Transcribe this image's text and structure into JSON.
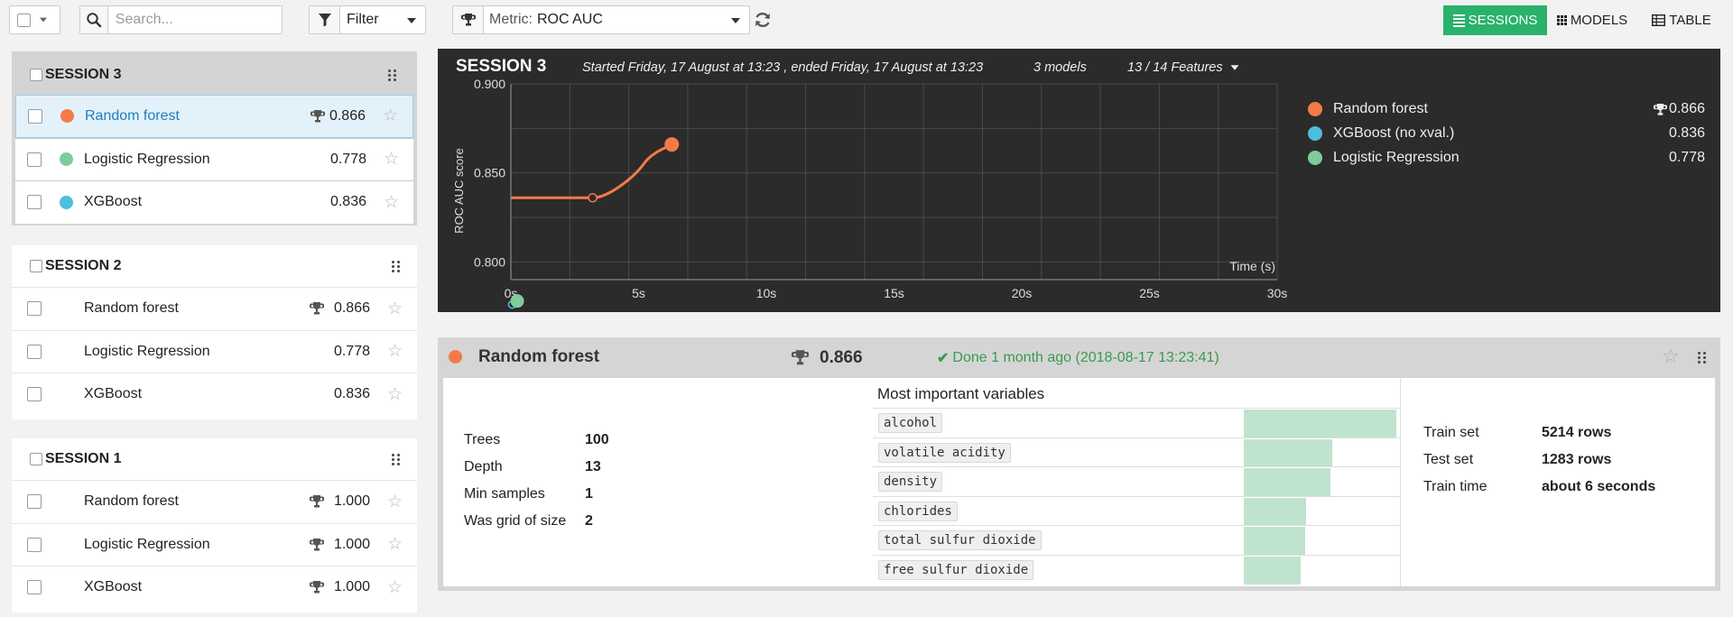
{
  "toolbar": {
    "search_placeholder": "Search...",
    "filter_label": "Filter",
    "metric_prefix": "Metric:",
    "metric_value": "ROC AUC",
    "views": [
      {
        "label": "SESSIONS",
        "active": true
      },
      {
        "label": "MODELS",
        "active": false
      },
      {
        "label": "TABLE",
        "active": false
      }
    ]
  },
  "sessions": [
    {
      "title": "SESSION 3",
      "models": [
        {
          "name": "Random forest",
          "color": "#f47b47",
          "score": "0.866",
          "best": true,
          "active": true
        },
        {
          "name": "Logistic Regression",
          "color": "#7fcb9c",
          "score": "0.778",
          "best": false,
          "active": false
        },
        {
          "name": "XGBoost",
          "color": "#4ebedf",
          "score": "0.836",
          "best": false,
          "active": false
        }
      ]
    },
    {
      "title": "SESSION 2",
      "models": [
        {
          "name": "Random forest",
          "score": "0.866",
          "best": true
        },
        {
          "name": "Logistic Regression",
          "score": "0.778",
          "best": false
        },
        {
          "name": "XGBoost",
          "score": "0.836",
          "best": false
        }
      ]
    },
    {
      "title": "SESSION 1",
      "models": [
        {
          "name": "Random forest",
          "score": "1.000",
          "best": true
        },
        {
          "name": "Logistic Regression",
          "score": "1.000",
          "best": true
        },
        {
          "name": "XGBoost",
          "score": "1.000",
          "best": true
        }
      ]
    }
  ],
  "chart_panel": {
    "title": "SESSION 3",
    "started": "Started Friday, 17 August at 13:23 , ended Friday, 17 August at 13:23",
    "models_count": "3 models",
    "features": "13 / 14 Features",
    "legend": [
      {
        "name": "Random forest",
        "color": "#f47b47",
        "value": "0.866",
        "best": true
      },
      {
        "name": "XGBoost (no xval.)",
        "color": "#4ebedf",
        "value": "0.836",
        "best": false
      },
      {
        "name": "Logistic Regression",
        "color": "#7fcb9c",
        "value": "0.778",
        "best": false
      }
    ]
  },
  "chart_data": {
    "type": "line",
    "xlabel": "Time (s)",
    "ylabel": "ROC AUC score",
    "xlim": [
      0,
      30
    ],
    "ylim": [
      0.79,
      0.9
    ],
    "x_ticks": [
      "0s",
      "5s",
      "10s",
      "15s",
      "20s",
      "25s",
      "30s"
    ],
    "y_ticks": [
      "0.800",
      "0.850",
      "0.900"
    ],
    "grid": true,
    "series": [
      {
        "name": "Random forest",
        "color": "#f47b47",
        "points": [
          [
            0,
            0.836
          ],
          [
            3.2,
            0.836
          ],
          [
            4.2,
            0.843
          ],
          [
            5.2,
            0.855
          ],
          [
            6.3,
            0.866
          ]
        ]
      },
      {
        "name": "Logistic Regression",
        "color": "#7fcb9c",
        "points": [
          [
            0.25,
            0.778
          ]
        ]
      },
      {
        "name": "XGBoost (no xval.)",
        "color": "#4ebedf",
        "points": [
          [
            0.05,
            0.776
          ]
        ]
      }
    ]
  },
  "detail": {
    "model_name": "Random forest",
    "score": "0.866",
    "status": "Done 1 month ago (2018-08-17 13:23:41)",
    "params": [
      {
        "label": "Trees",
        "value": "100"
      },
      {
        "label": "Depth",
        "value": "13"
      },
      {
        "label": "Min samples",
        "value": "1"
      },
      {
        "label": "Was grid of size",
        "value": "2"
      }
    ],
    "variables_title": "Most important variables",
    "variables": [
      {
        "name": "alcohol",
        "importance": 1.0
      },
      {
        "name": "volatile acidity",
        "importance": 0.58
      },
      {
        "name": "density",
        "importance": 0.57
      },
      {
        "name": "chlorides",
        "importance": 0.41
      },
      {
        "name": "total sulfur dioxide",
        "importance": 0.4
      },
      {
        "name": "free sulfur dioxide",
        "importance": 0.37
      }
    ],
    "train_info": [
      {
        "label": "Train set",
        "value": "5214 rows"
      },
      {
        "label": "Test set",
        "value": "1283 rows"
      },
      {
        "label": "Train time",
        "value": "about 6 seconds"
      }
    ]
  }
}
